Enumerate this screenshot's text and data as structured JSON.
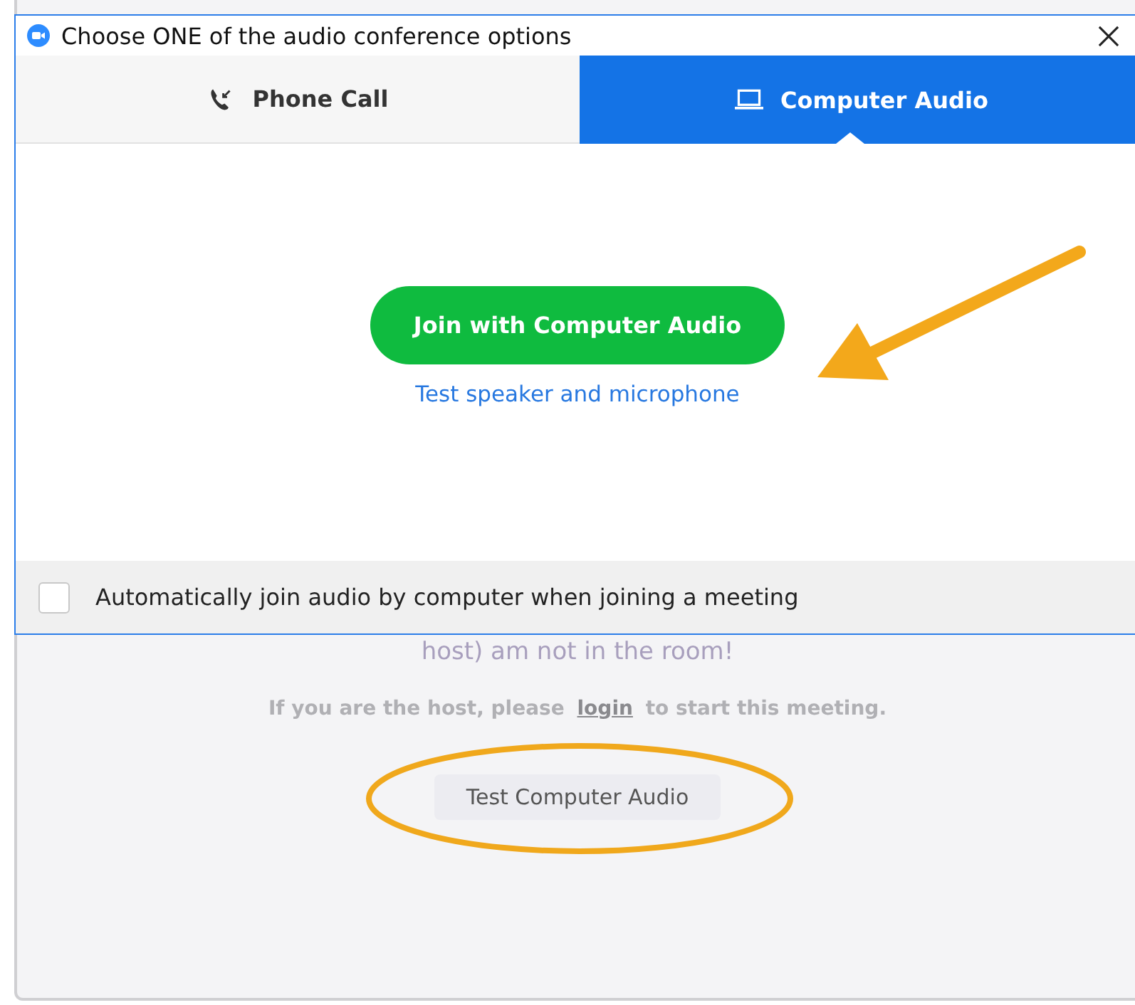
{
  "dialog": {
    "title": "Choose ONE of the audio conference options",
    "tabs": [
      {
        "label": "Phone Call",
        "kind": "phone",
        "selected": false
      },
      {
        "label": "Computer Audio",
        "kind": "computer",
        "selected": true
      }
    ],
    "join_button": "Join with Computer Audio",
    "test_link": "Test speaker and microphone",
    "auto_join": {
      "label": "Automatically join audio by computer when joining a meeting",
      "checked": false
    }
  },
  "background_window": {
    "message_fragment": "host) am not in the room!",
    "host_notice": {
      "before": "If you are the host, please",
      "link": "login",
      "after": "to start this meeting."
    },
    "test_button": "Test Computer Audio"
  }
}
